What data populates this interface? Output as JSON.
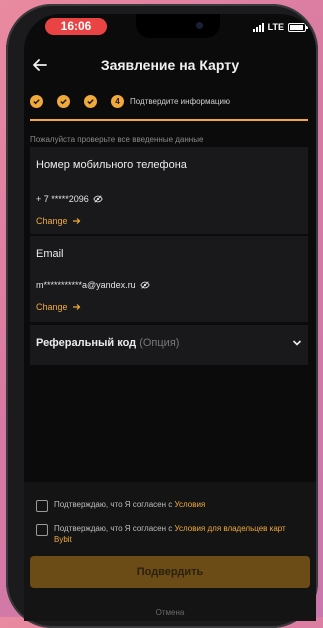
{
  "status": {
    "time": "16:06",
    "network": "LTE"
  },
  "header": {
    "title": "Заявление на Карту"
  },
  "steps": {
    "active_number": "4",
    "label": "Подтвердите информацию"
  },
  "hint": "Пожалуйста проверьте все введенные данные",
  "phone_card": {
    "title": "Номер мобильного телефона",
    "value": "+ 7 *****2096",
    "change": "Change"
  },
  "email_card": {
    "title": "Email",
    "value": "m***********a@yandex.ru",
    "change": "Change"
  },
  "referral": {
    "title": "Реферальный код",
    "optional": "(Опция)"
  },
  "consents": [
    {
      "text": "Подтверждаю, что Я согласен с ",
      "link": "Условия"
    },
    {
      "text": "Подтверждаю, что Я согласен с ",
      "link": "Условия для владельцев карт Bybit"
    }
  ],
  "buttons": {
    "confirm": "Подвердить",
    "cancel": "Отмена"
  },
  "colors": {
    "accent": "#f0a93a",
    "background": "#0b0b0c",
    "card": "#19191b",
    "status_pill": "#ea4343"
  },
  "icons": [
    "back-arrow-icon",
    "check-icon",
    "eye-off-icon",
    "arrow-right-icon",
    "chevron-down-icon",
    "signal-icon",
    "battery-icon"
  ]
}
